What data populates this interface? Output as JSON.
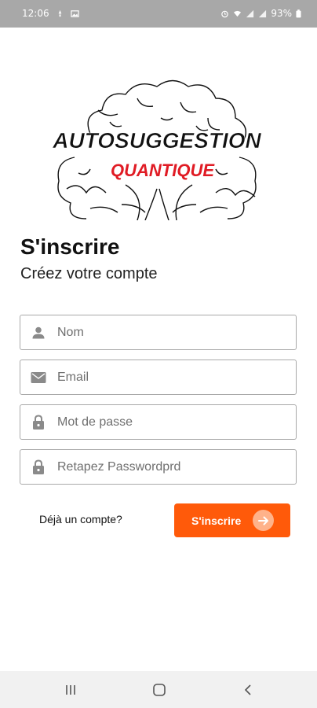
{
  "status_bar": {
    "time": "12:06",
    "battery": "93%"
  },
  "logo": {
    "line1": "AUTOSUGGESTION",
    "line2": "QUANTIQUE"
  },
  "header": {
    "title": "S'inscrire",
    "subtitle": "Créez votre compte"
  },
  "form": {
    "name_placeholder": "Nom",
    "email_placeholder": "Email",
    "password_placeholder": "Mot de passe",
    "confirm_placeholder": "Retapez Passwordprd"
  },
  "actions": {
    "login_link": "Déjà un compte?",
    "signup_label": "S'inscrire"
  },
  "colors": {
    "accent": "#ff5a0a",
    "status_bar": "#a8a8a8"
  },
  "icons": [
    "person-icon",
    "mail-icon",
    "lock-icon",
    "arrow-right-icon",
    "recents-icon",
    "home-icon",
    "back-icon"
  ]
}
